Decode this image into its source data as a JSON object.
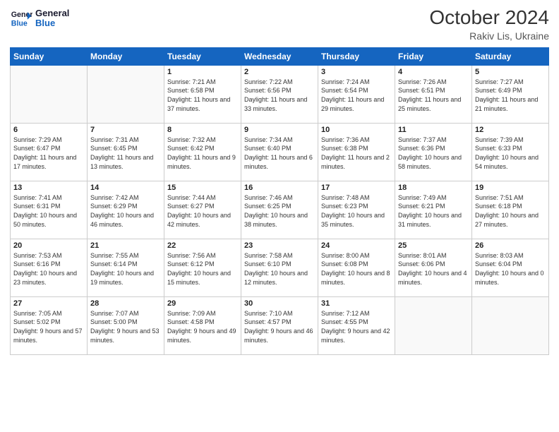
{
  "header": {
    "logo_line1": "General",
    "logo_line2": "Blue",
    "month": "October 2024",
    "location": "Rakiv Lis, Ukraine"
  },
  "weekdays": [
    "Sunday",
    "Monday",
    "Tuesday",
    "Wednesday",
    "Thursday",
    "Friday",
    "Saturday"
  ],
  "weeks": [
    [
      {
        "day": "",
        "empty": true
      },
      {
        "day": "",
        "empty": true
      },
      {
        "day": "1",
        "sunrise": "7:21 AM",
        "sunset": "6:58 PM",
        "daylight": "11 hours and 37 minutes."
      },
      {
        "day": "2",
        "sunrise": "7:22 AM",
        "sunset": "6:56 PM",
        "daylight": "11 hours and 33 minutes."
      },
      {
        "day": "3",
        "sunrise": "7:24 AM",
        "sunset": "6:54 PM",
        "daylight": "11 hours and 29 minutes."
      },
      {
        "day": "4",
        "sunrise": "7:26 AM",
        "sunset": "6:51 PM",
        "daylight": "11 hours and 25 minutes."
      },
      {
        "day": "5",
        "sunrise": "7:27 AM",
        "sunset": "6:49 PM",
        "daylight": "11 hours and 21 minutes."
      }
    ],
    [
      {
        "day": "6",
        "sunrise": "7:29 AM",
        "sunset": "6:47 PM",
        "daylight": "11 hours and 17 minutes."
      },
      {
        "day": "7",
        "sunrise": "7:31 AM",
        "sunset": "6:45 PM",
        "daylight": "11 hours and 13 minutes."
      },
      {
        "day": "8",
        "sunrise": "7:32 AM",
        "sunset": "6:42 PM",
        "daylight": "11 hours and 9 minutes."
      },
      {
        "day": "9",
        "sunrise": "7:34 AM",
        "sunset": "6:40 PM",
        "daylight": "11 hours and 6 minutes."
      },
      {
        "day": "10",
        "sunrise": "7:36 AM",
        "sunset": "6:38 PM",
        "daylight": "11 hours and 2 minutes."
      },
      {
        "day": "11",
        "sunrise": "7:37 AM",
        "sunset": "6:36 PM",
        "daylight": "10 hours and 58 minutes."
      },
      {
        "day": "12",
        "sunrise": "7:39 AM",
        "sunset": "6:33 PM",
        "daylight": "10 hours and 54 minutes."
      }
    ],
    [
      {
        "day": "13",
        "sunrise": "7:41 AM",
        "sunset": "6:31 PM",
        "daylight": "10 hours and 50 minutes."
      },
      {
        "day": "14",
        "sunrise": "7:42 AM",
        "sunset": "6:29 PM",
        "daylight": "10 hours and 46 minutes."
      },
      {
        "day": "15",
        "sunrise": "7:44 AM",
        "sunset": "6:27 PM",
        "daylight": "10 hours and 42 minutes."
      },
      {
        "day": "16",
        "sunrise": "7:46 AM",
        "sunset": "6:25 PM",
        "daylight": "10 hours and 38 minutes."
      },
      {
        "day": "17",
        "sunrise": "7:48 AM",
        "sunset": "6:23 PM",
        "daylight": "10 hours and 35 minutes."
      },
      {
        "day": "18",
        "sunrise": "7:49 AM",
        "sunset": "6:21 PM",
        "daylight": "10 hours and 31 minutes."
      },
      {
        "day": "19",
        "sunrise": "7:51 AM",
        "sunset": "6:18 PM",
        "daylight": "10 hours and 27 minutes."
      }
    ],
    [
      {
        "day": "20",
        "sunrise": "7:53 AM",
        "sunset": "6:16 PM",
        "daylight": "10 hours and 23 minutes."
      },
      {
        "day": "21",
        "sunrise": "7:55 AM",
        "sunset": "6:14 PM",
        "daylight": "10 hours and 19 minutes."
      },
      {
        "day": "22",
        "sunrise": "7:56 AM",
        "sunset": "6:12 PM",
        "daylight": "10 hours and 15 minutes."
      },
      {
        "day": "23",
        "sunrise": "7:58 AM",
        "sunset": "6:10 PM",
        "daylight": "10 hours and 12 minutes."
      },
      {
        "day": "24",
        "sunrise": "8:00 AM",
        "sunset": "6:08 PM",
        "daylight": "10 hours and 8 minutes."
      },
      {
        "day": "25",
        "sunrise": "8:01 AM",
        "sunset": "6:06 PM",
        "daylight": "10 hours and 4 minutes."
      },
      {
        "day": "26",
        "sunrise": "8:03 AM",
        "sunset": "6:04 PM",
        "daylight": "10 hours and 0 minutes."
      }
    ],
    [
      {
        "day": "27",
        "sunrise": "7:05 AM",
        "sunset": "5:02 PM",
        "daylight": "9 hours and 57 minutes."
      },
      {
        "day": "28",
        "sunrise": "7:07 AM",
        "sunset": "5:00 PM",
        "daylight": "9 hours and 53 minutes."
      },
      {
        "day": "29",
        "sunrise": "7:09 AM",
        "sunset": "4:58 PM",
        "daylight": "9 hours and 49 minutes."
      },
      {
        "day": "30",
        "sunrise": "7:10 AM",
        "sunset": "4:57 PM",
        "daylight": "9 hours and 46 minutes."
      },
      {
        "day": "31",
        "sunrise": "7:12 AM",
        "sunset": "4:55 PM",
        "daylight": "9 hours and 42 minutes."
      },
      {
        "day": "",
        "empty": true
      },
      {
        "day": "",
        "empty": true
      }
    ]
  ]
}
